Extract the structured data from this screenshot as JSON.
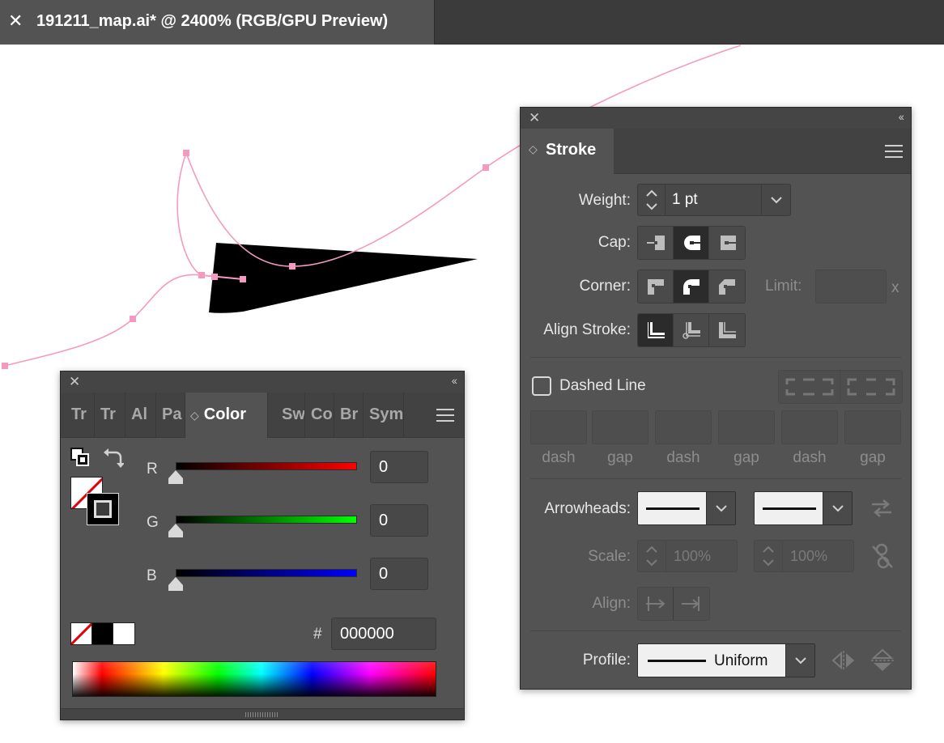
{
  "document_tab": {
    "close_glyph": "✕",
    "title": "191211_map.ai* @ 2400% (RGB/GPU Preview)"
  },
  "canvas": {
    "path_color": "#f49ac1",
    "anchor_color": "#f49ac1",
    "shape_fill": "#000000"
  },
  "stroke_panel": {
    "close_glyph": "✕",
    "collapse_glyph": "‹‹",
    "tab_label": "Stroke",
    "weight": {
      "label": "Weight:",
      "value": "1 pt"
    },
    "cap": {
      "label": "Cap:",
      "options": [
        "butt-cap",
        "round-cap",
        "projecting-cap"
      ],
      "selected": "round-cap"
    },
    "corner": {
      "label": "Corner:",
      "options": [
        "miter-join",
        "round-join",
        "bevel-join"
      ],
      "selected": "round-join",
      "limit_label": "Limit:",
      "limit_value": "",
      "limit_suffix": "x"
    },
    "align_stroke": {
      "label": "Align Stroke:",
      "options": [
        "align-center",
        "align-inside",
        "align-outside"
      ],
      "selected": "align-center"
    },
    "dashed_line": {
      "label": "Dashed Line",
      "checked": false
    },
    "dash_fields": [
      {
        "label": "dash",
        "value": ""
      },
      {
        "label": "gap",
        "value": ""
      },
      {
        "label": "dash",
        "value": ""
      },
      {
        "label": "gap",
        "value": ""
      },
      {
        "label": "dash",
        "value": ""
      },
      {
        "label": "gap",
        "value": ""
      }
    ],
    "arrowheads": {
      "label": "Arrowheads:"
    },
    "scale": {
      "label": "Scale:",
      "start": "100%",
      "end": "100%"
    },
    "align": {
      "label": "Align:"
    },
    "profile": {
      "label": "Profile:",
      "value": "Uniform"
    }
  },
  "color_panel": {
    "close_glyph": "✕",
    "collapse_glyph": "‹‹",
    "tabs": [
      "Tr",
      "Tr",
      "Al",
      "Pa",
      "Color",
      "Sw",
      "Co",
      "Br",
      "Sym"
    ],
    "active_tab": "Color",
    "sliders": [
      {
        "label": "R",
        "value": "0",
        "color": "#ff0000"
      },
      {
        "label": "G",
        "value": "0",
        "color": "#00ff00"
      },
      {
        "label": "B",
        "value": "0",
        "color": "#0000ff"
      }
    ],
    "hex_label": "#",
    "hex_value": "000000"
  }
}
